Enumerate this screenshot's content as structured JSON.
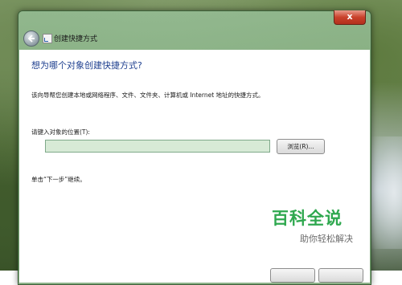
{
  "window": {
    "title": "创建快捷方式",
    "close_label": "x"
  },
  "wizard": {
    "heading": "想为哪个对象创建快捷方式?",
    "description": "该向导帮您创建本地或网络程序、文件、文件夹、计算机或 Internet 地址的快捷方式。",
    "location_label": "请键入对象的位置(T):",
    "location_value": "",
    "browse_label": "浏览(R)...",
    "hint": "单击“下一步”继续。"
  },
  "watermark": {
    "title": "百科全说",
    "subtitle": "助你轻松解决",
    "color": "#2fa84f"
  },
  "icons": [
    "back-arrow-icon",
    "shortcut-app-icon",
    "close-icon"
  ]
}
